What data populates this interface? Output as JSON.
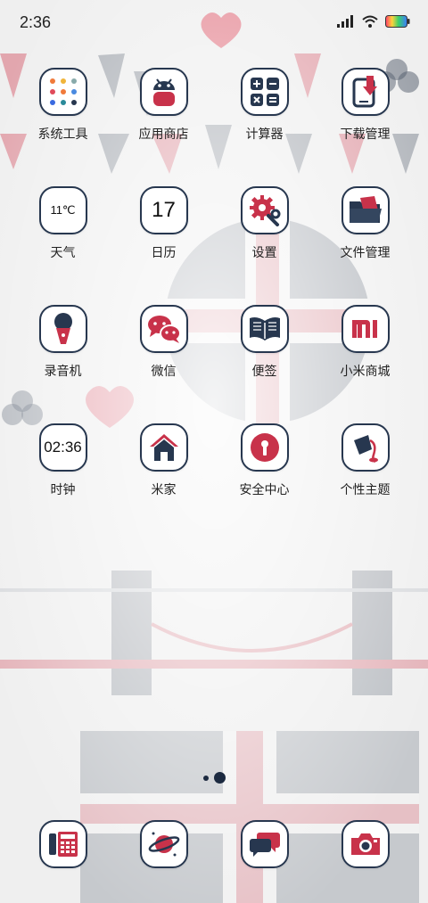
{
  "status_bar": {
    "time": "2:36"
  },
  "apps": [
    {
      "label": "系统工具",
      "icon": "folder-icon"
    },
    {
      "label": "应用商店",
      "icon": "android-robot-icon"
    },
    {
      "label": "计算器",
      "icon": "calculator-icon"
    },
    {
      "label": "下载管理",
      "icon": "download-icon"
    },
    {
      "label": "天气",
      "icon": "weather-icon",
      "icon_text": "11℃"
    },
    {
      "label": "日历",
      "icon": "calendar-icon",
      "icon_text": "17"
    },
    {
      "label": "设置",
      "icon": "gear-icon"
    },
    {
      "label": "文件管理",
      "icon": "file-folder-icon"
    },
    {
      "label": "录音机",
      "icon": "microphone-icon"
    },
    {
      "label": "微信",
      "icon": "chat-bubbles-icon"
    },
    {
      "label": "便签",
      "icon": "book-icon"
    },
    {
      "label": "小米商城",
      "icon": "mi-logo-icon",
      "icon_text": "MI"
    },
    {
      "label": "时钟",
      "icon": "clock-icon",
      "icon_text": "02:36"
    },
    {
      "label": "米家",
      "icon": "home-icon"
    },
    {
      "label": "安全中心",
      "icon": "shield-keyhole-icon"
    },
    {
      "label": "个性主题",
      "icon": "paint-bucket-icon"
    }
  ],
  "dock": [
    {
      "icon": "phone-icon"
    },
    {
      "icon": "planet-browser-icon"
    },
    {
      "icon": "messages-icon"
    },
    {
      "icon": "camera-icon"
    }
  ],
  "colors": {
    "navy": "#27374f",
    "red": "#c8324a",
    "background": "#f2f2f2"
  }
}
